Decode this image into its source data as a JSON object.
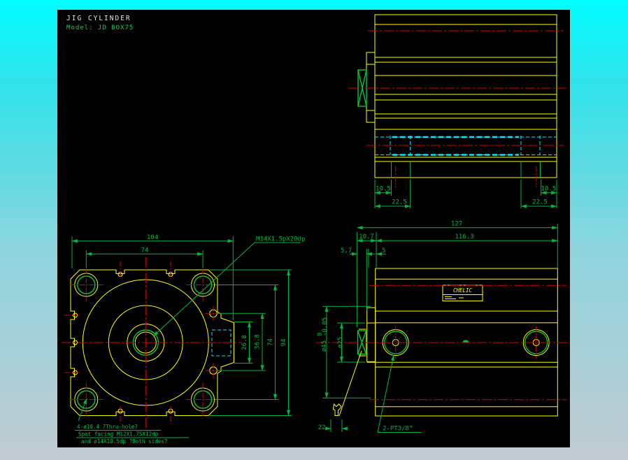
{
  "header": {
    "title": "JIG CYLINDER",
    "model": "Model: JD BOX75"
  },
  "colors": {
    "outline": "#ffff00",
    "dimension": "#00b43c",
    "centerline": "#d40000",
    "hidden": "#00e8ff",
    "canvas": "#000000",
    "title_text": "#e6e6e6",
    "background_top": "#00feff",
    "background_bottom": "#c2cbd2"
  },
  "top_view": {
    "dim_port_offset_left": "10.5",
    "dim_slot_left": "22.5",
    "dim_port_offset_right": "10.5",
    "dim_slot_right": "22.5"
  },
  "front_view": {
    "dim_overall_width": "104",
    "dim_bolt_pitch_h": "74",
    "thread_callout": "M14X1.5pX20dp",
    "dim_port_boss_inner": "26.8",
    "dim_port_boss_outer": "36.8",
    "dim_bolt_pitch_v": "74",
    "dim_body_height": "94",
    "note_line1": "4-ø10.4 ?Thru-hole?",
    "note_line2": "Spot facing M12X1.75X12dp",
    "note_line3": "and ø14X10.5dp ?Both sides?"
  },
  "side_view": {
    "dim_overall_length": "127",
    "dim_body_length": "116.3",
    "dim_head_length": "10.7",
    "dim_plate_thk": "5,7",
    "dim_step": "5",
    "rod_dia": "ø25",
    "plate_dia": "ø45",
    "plate_dia_tol_upper": "0",
    "plate_dia_tol_lower": "-0.05",
    "wrench_flats": "22",
    "port_callout": "2-PT3/8\"",
    "nameplate_brand": "CHELIC"
  }
}
